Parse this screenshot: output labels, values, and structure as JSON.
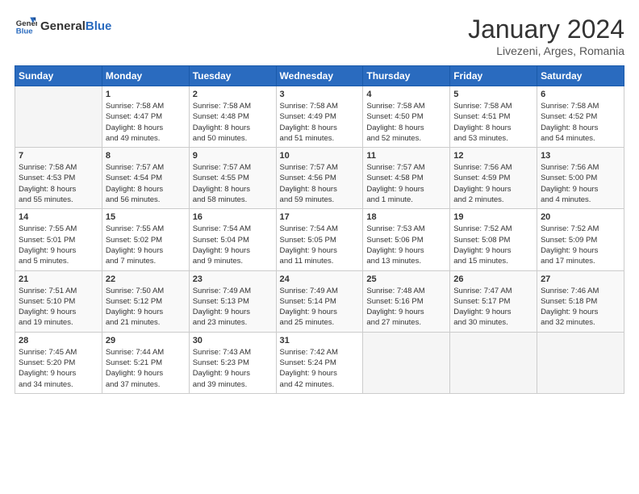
{
  "logo": {
    "general": "General",
    "blue": "Blue"
  },
  "title": "January 2024",
  "subtitle": "Livezeni, Arges, Romania",
  "days_of_week": [
    "Sunday",
    "Monday",
    "Tuesday",
    "Wednesday",
    "Thursday",
    "Friday",
    "Saturday"
  ],
  "weeks": [
    [
      {
        "day": "",
        "sunrise": "",
        "sunset": "",
        "daylight": ""
      },
      {
        "day": "1",
        "sunrise": "Sunrise: 7:58 AM",
        "sunset": "Sunset: 4:47 PM",
        "daylight": "Daylight: 8 hours and 49 minutes."
      },
      {
        "day": "2",
        "sunrise": "Sunrise: 7:58 AM",
        "sunset": "Sunset: 4:48 PM",
        "daylight": "Daylight: 8 hours and 50 minutes."
      },
      {
        "day": "3",
        "sunrise": "Sunrise: 7:58 AM",
        "sunset": "Sunset: 4:49 PM",
        "daylight": "Daylight: 8 hours and 51 minutes."
      },
      {
        "day": "4",
        "sunrise": "Sunrise: 7:58 AM",
        "sunset": "Sunset: 4:50 PM",
        "daylight": "Daylight: 8 hours and 52 minutes."
      },
      {
        "day": "5",
        "sunrise": "Sunrise: 7:58 AM",
        "sunset": "Sunset: 4:51 PM",
        "daylight": "Daylight: 8 hours and 53 minutes."
      },
      {
        "day": "6",
        "sunrise": "Sunrise: 7:58 AM",
        "sunset": "Sunset: 4:52 PM",
        "daylight": "Daylight: 8 hours and 54 minutes."
      }
    ],
    [
      {
        "day": "7",
        "sunrise": "Sunrise: 7:58 AM",
        "sunset": "Sunset: 4:53 PM",
        "daylight": "Daylight: 8 hours and 55 minutes."
      },
      {
        "day": "8",
        "sunrise": "Sunrise: 7:57 AM",
        "sunset": "Sunset: 4:54 PM",
        "daylight": "Daylight: 8 hours and 56 minutes."
      },
      {
        "day": "9",
        "sunrise": "Sunrise: 7:57 AM",
        "sunset": "Sunset: 4:55 PM",
        "daylight": "Daylight: 8 hours and 58 minutes."
      },
      {
        "day": "10",
        "sunrise": "Sunrise: 7:57 AM",
        "sunset": "Sunset: 4:56 PM",
        "daylight": "Daylight: 8 hours and 59 minutes."
      },
      {
        "day": "11",
        "sunrise": "Sunrise: 7:57 AM",
        "sunset": "Sunset: 4:58 PM",
        "daylight": "Daylight: 9 hours and 1 minute."
      },
      {
        "day": "12",
        "sunrise": "Sunrise: 7:56 AM",
        "sunset": "Sunset: 4:59 PM",
        "daylight": "Daylight: 9 hours and 2 minutes."
      },
      {
        "day": "13",
        "sunrise": "Sunrise: 7:56 AM",
        "sunset": "Sunset: 5:00 PM",
        "daylight": "Daylight: 9 hours and 4 minutes."
      }
    ],
    [
      {
        "day": "14",
        "sunrise": "Sunrise: 7:55 AM",
        "sunset": "Sunset: 5:01 PM",
        "daylight": "Daylight: 9 hours and 5 minutes."
      },
      {
        "day": "15",
        "sunrise": "Sunrise: 7:55 AM",
        "sunset": "Sunset: 5:02 PM",
        "daylight": "Daylight: 9 hours and 7 minutes."
      },
      {
        "day": "16",
        "sunrise": "Sunrise: 7:54 AM",
        "sunset": "Sunset: 5:04 PM",
        "daylight": "Daylight: 9 hours and 9 minutes."
      },
      {
        "day": "17",
        "sunrise": "Sunrise: 7:54 AM",
        "sunset": "Sunset: 5:05 PM",
        "daylight": "Daylight: 9 hours and 11 minutes."
      },
      {
        "day": "18",
        "sunrise": "Sunrise: 7:53 AM",
        "sunset": "Sunset: 5:06 PM",
        "daylight": "Daylight: 9 hours and 13 minutes."
      },
      {
        "day": "19",
        "sunrise": "Sunrise: 7:52 AM",
        "sunset": "Sunset: 5:08 PM",
        "daylight": "Daylight: 9 hours and 15 minutes."
      },
      {
        "day": "20",
        "sunrise": "Sunrise: 7:52 AM",
        "sunset": "Sunset: 5:09 PM",
        "daylight": "Daylight: 9 hours and 17 minutes."
      }
    ],
    [
      {
        "day": "21",
        "sunrise": "Sunrise: 7:51 AM",
        "sunset": "Sunset: 5:10 PM",
        "daylight": "Daylight: 9 hours and 19 minutes."
      },
      {
        "day": "22",
        "sunrise": "Sunrise: 7:50 AM",
        "sunset": "Sunset: 5:12 PM",
        "daylight": "Daylight: 9 hours and 21 minutes."
      },
      {
        "day": "23",
        "sunrise": "Sunrise: 7:49 AM",
        "sunset": "Sunset: 5:13 PM",
        "daylight": "Daylight: 9 hours and 23 minutes."
      },
      {
        "day": "24",
        "sunrise": "Sunrise: 7:49 AM",
        "sunset": "Sunset: 5:14 PM",
        "daylight": "Daylight: 9 hours and 25 minutes."
      },
      {
        "day": "25",
        "sunrise": "Sunrise: 7:48 AM",
        "sunset": "Sunset: 5:16 PM",
        "daylight": "Daylight: 9 hours and 27 minutes."
      },
      {
        "day": "26",
        "sunrise": "Sunrise: 7:47 AM",
        "sunset": "Sunset: 5:17 PM",
        "daylight": "Daylight: 9 hours and 30 minutes."
      },
      {
        "day": "27",
        "sunrise": "Sunrise: 7:46 AM",
        "sunset": "Sunset: 5:18 PM",
        "daylight": "Daylight: 9 hours and 32 minutes."
      }
    ],
    [
      {
        "day": "28",
        "sunrise": "Sunrise: 7:45 AM",
        "sunset": "Sunset: 5:20 PM",
        "daylight": "Daylight: 9 hours and 34 minutes."
      },
      {
        "day": "29",
        "sunrise": "Sunrise: 7:44 AM",
        "sunset": "Sunset: 5:21 PM",
        "daylight": "Daylight: 9 hours and 37 minutes."
      },
      {
        "day": "30",
        "sunrise": "Sunrise: 7:43 AM",
        "sunset": "Sunset: 5:23 PM",
        "daylight": "Daylight: 9 hours and 39 minutes."
      },
      {
        "day": "31",
        "sunrise": "Sunrise: 7:42 AM",
        "sunset": "Sunset: 5:24 PM",
        "daylight": "Daylight: 9 hours and 42 minutes."
      },
      {
        "day": "",
        "sunrise": "",
        "sunset": "",
        "daylight": ""
      },
      {
        "day": "",
        "sunrise": "",
        "sunset": "",
        "daylight": ""
      },
      {
        "day": "",
        "sunrise": "",
        "sunset": "",
        "daylight": ""
      }
    ]
  ]
}
